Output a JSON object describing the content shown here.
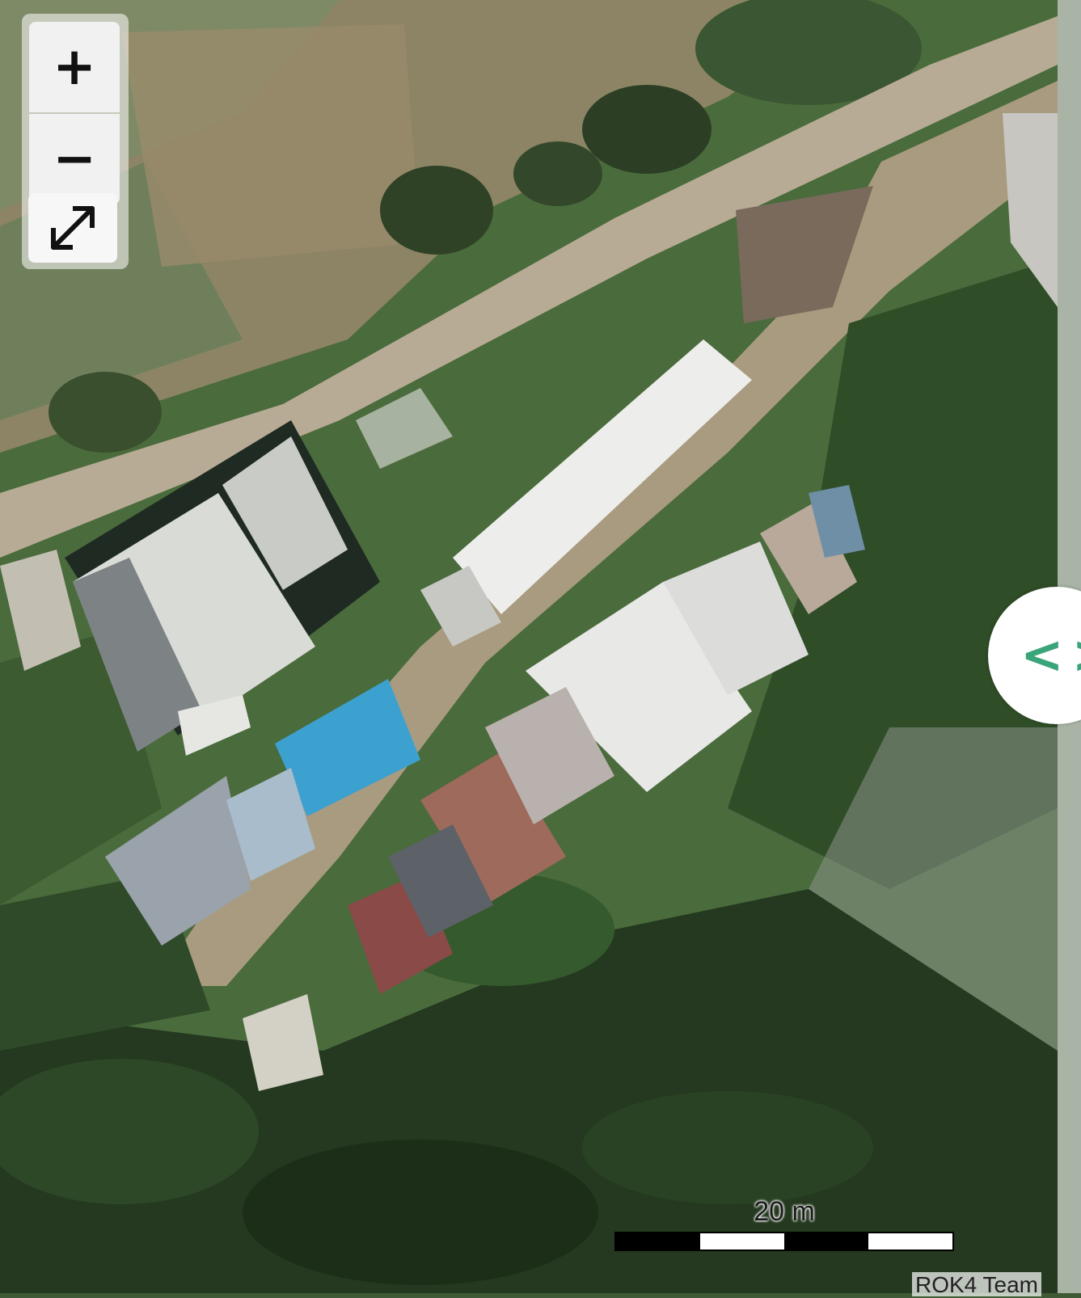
{
  "map": {
    "imagery": "aerial-photo",
    "zoom_in_label": "+",
    "zoom_out_label": "−",
    "fullscreen_icon": "expand-arrows-icon",
    "swipe_icon": "compare-slider-icon",
    "swipe_glyph": "<>",
    "accent_color": "#3aa47a",
    "scale": {
      "label": "20 m",
      "segments": 4
    },
    "attribution": "ROK4 Team"
  }
}
